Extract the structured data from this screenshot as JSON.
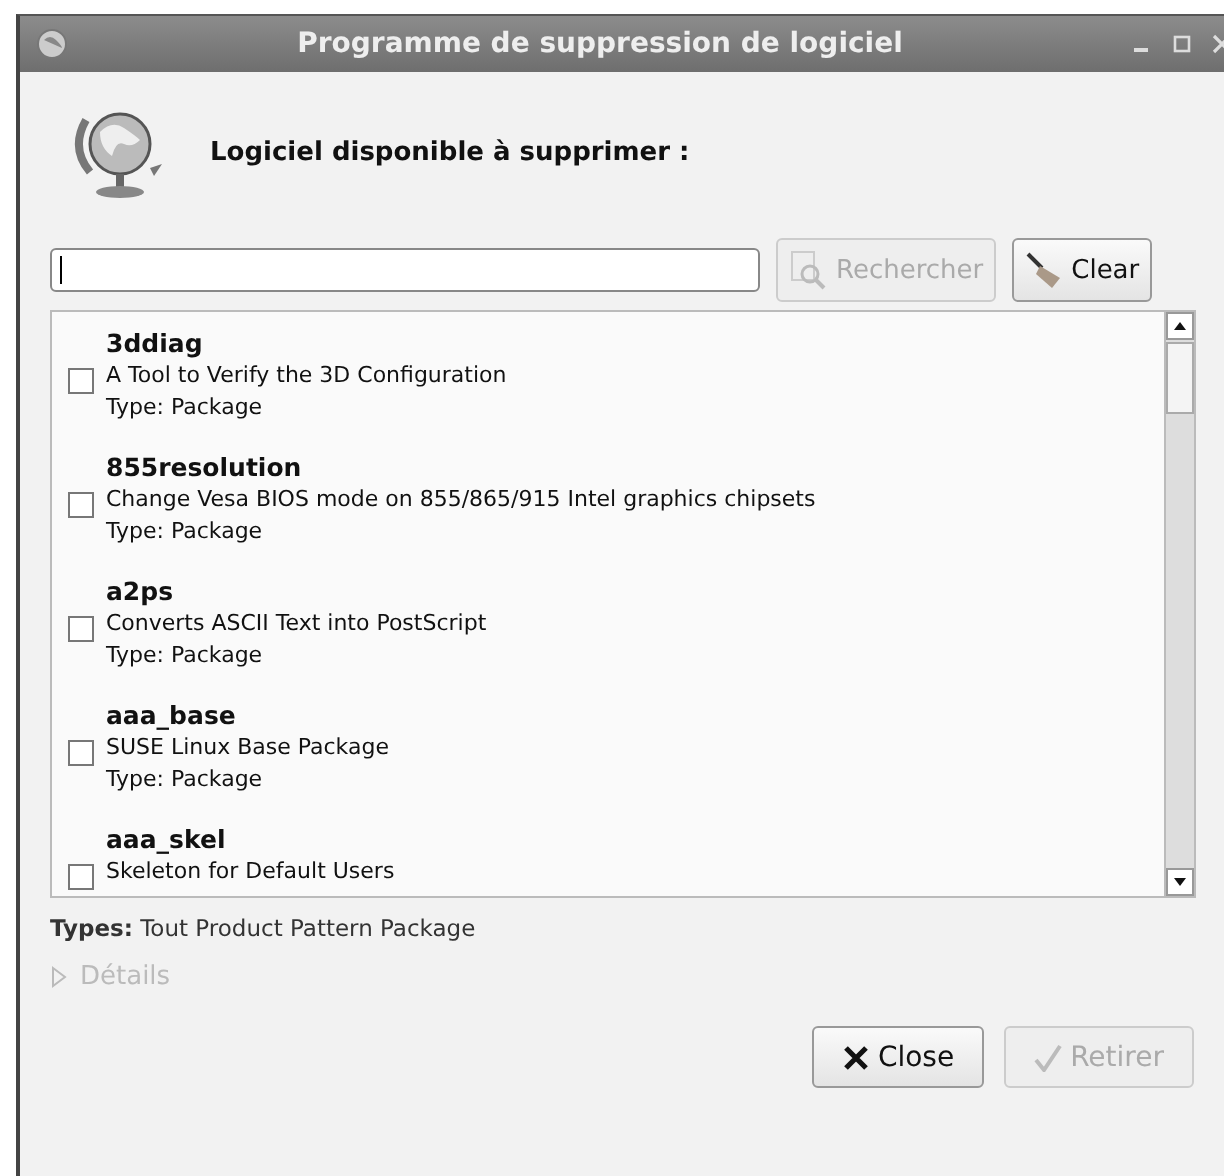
{
  "window": {
    "title": "Programme de suppression de logiciel"
  },
  "heading": "Logiciel disponible à supprimer :",
  "search": {
    "search_button": {
      "label": "Rechercher",
      "disabled": true
    },
    "clear_button": {
      "label": "Clear",
      "disabled": false
    }
  },
  "packages": [
    {
      "name": "3ddiag",
      "description": "A Tool to Verify the 3D Configuration",
      "type": "Type: Package",
      "checked": false
    },
    {
      "name": "855resolution",
      "description": "Change Vesa BIOS mode on 855/865/915 Intel graphics chipsets",
      "type": "Type: Package",
      "checked": false
    },
    {
      "name": "a2ps",
      "description": "Converts ASCII Text into PostScript",
      "type": "Type: Package",
      "checked": false
    },
    {
      "name": "aaa_base",
      "description": "SUSE Linux Base Package",
      "type": "Type: Package",
      "checked": false
    },
    {
      "name": "aaa_skel",
      "description": "Skeleton for Default Users",
      "checked": false
    }
  ],
  "types": {
    "label": "Types:",
    "value": "Tout Product Pattern Package"
  },
  "details": {
    "label": "Détails",
    "expanded": false,
    "disabled": true
  },
  "buttons": [
    {
      "label": "Close",
      "kind": "close",
      "disabled": false
    },
    {
      "label": "Retirer",
      "kind": "apply",
      "disabled": true
    }
  ]
}
